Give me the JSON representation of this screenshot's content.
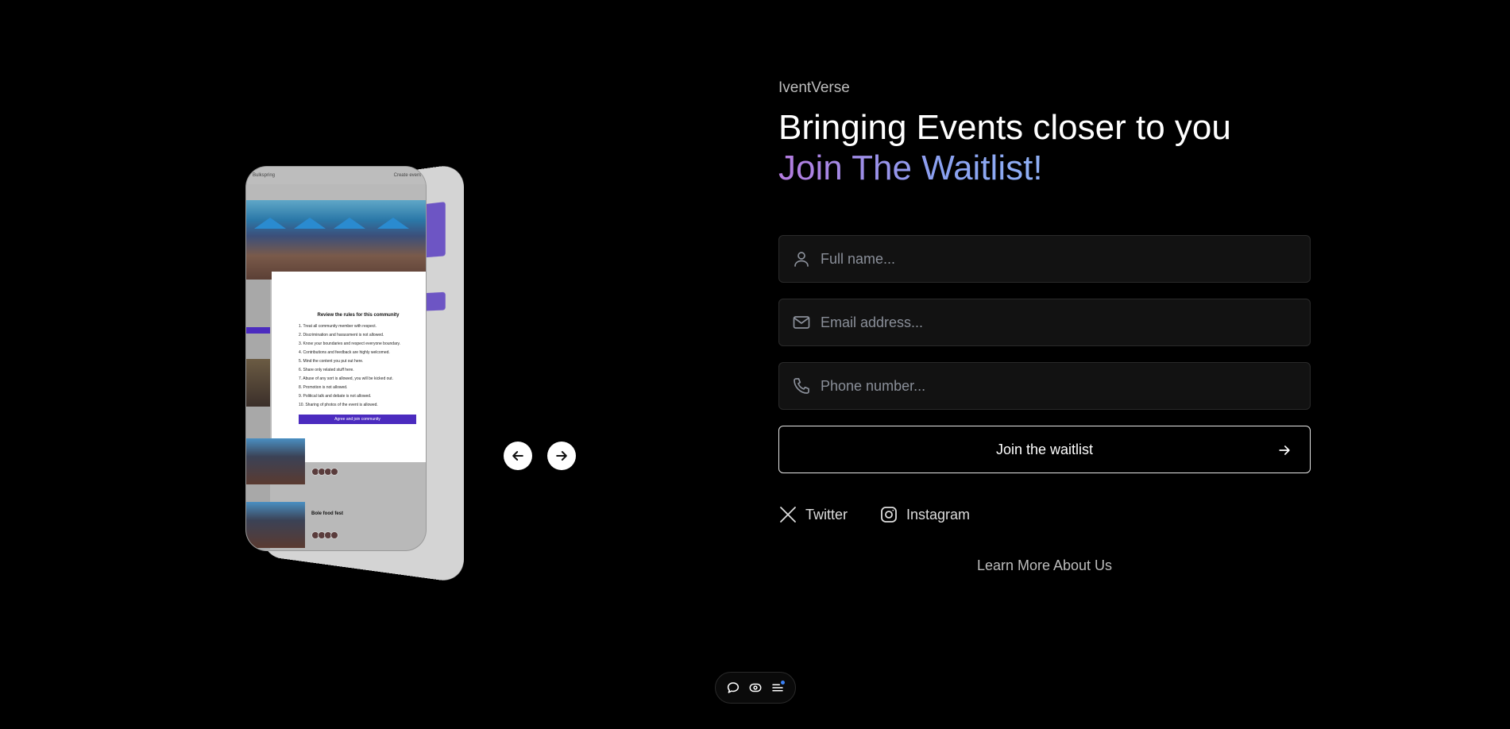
{
  "brand": {
    "name": "IventVerse"
  },
  "hero": {
    "headline": "Bringing Events closer to you",
    "subheadline": "Join The Waitlist!"
  },
  "form": {
    "fullname": {
      "placeholder": "Full name...",
      "icon": "user-icon"
    },
    "email": {
      "placeholder": "Email address...",
      "icon": "mail-icon"
    },
    "phone": {
      "placeholder": "Phone number...",
      "icon": "phone-icon"
    },
    "submit_label": "Join the waitlist"
  },
  "social": {
    "twitter_label": "Twitter",
    "instagram_label": "Instagram"
  },
  "learn_more_label": "Learn More About Us",
  "phone_mockup": {
    "topbar_left": "Bulkspring",
    "topbar_right": "Create event",
    "modal_title": "Review the rules for this community",
    "rules": [
      "1.  Treat all community member with respect.",
      "2.  Discrimination and harassment is not allowed.",
      "3.  Know your boundaries and respect everyone boundary.",
      "4.  Contributions and feedback are highly welcomed.",
      "5.  Mind the content you put out here.",
      "6.  Share only related stuff here.",
      "7.  Abuse of any sort is allowed, you will be kicked out.",
      "8.  Promotion is not allowed.",
      "9.  Political talk and debate is not allowed.",
      "10.  Sharing of photos of the event is allowed."
    ],
    "modal_button": "Agree and join community",
    "card_title": "Bole food fest"
  },
  "colors": {
    "background": "#000000",
    "accent_purple": "#4b2bbf",
    "gradient_start": "#b57be0",
    "gradient_end": "#8fb0f5"
  }
}
